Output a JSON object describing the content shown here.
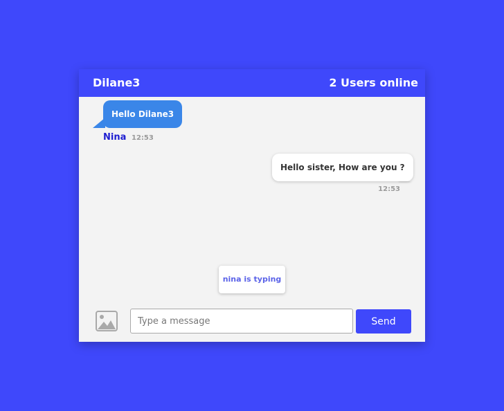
{
  "header": {
    "username": "Dilane3",
    "online_status": "2 Users online"
  },
  "messages": [
    {
      "text": "Hello Dilane3",
      "sender": "Nina",
      "time": "12:53",
      "direction": "incoming"
    },
    {
      "text": "Hello sister, How are you ?",
      "time": "12:53",
      "direction": "outgoing"
    }
  ],
  "typing_indicator": "nina is typing",
  "composer": {
    "placeholder": "Type a message",
    "value": "",
    "send_label": "Send",
    "attach_icon": "image-icon"
  },
  "colors": {
    "page_background": "#3f48fb",
    "header": "#3f48fb",
    "incoming_bubble": "#3a86e8",
    "outgoing_bubble": "#ffffff",
    "sender_name": "#1f1fd1",
    "typing_text": "#5b63e8",
    "send_button": "#3f48fb"
  }
}
